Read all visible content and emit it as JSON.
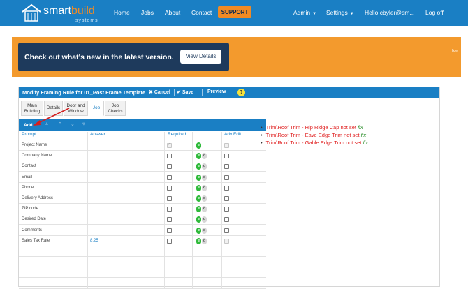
{
  "navbar": {
    "brand_main": "smart",
    "brand_accent": "build",
    "brand_sub": "systems",
    "links": [
      "Home",
      "Jobs",
      "About",
      "Contact"
    ],
    "support": "SUPPORT",
    "admin": "Admin",
    "settings": "Settings",
    "hello": "Hello cbyler@sm...",
    "logoff": "Log off"
  },
  "banner": {
    "text": "Check out what's new in the latest version.",
    "button": "View Details",
    "hide": "Hide"
  },
  "panel": {
    "title": "Modify Framing Rule for 01_Post Frame Template",
    "cancel": "Cancel",
    "save": "Save",
    "preview": "Preview",
    "help": "?"
  },
  "tabs": [
    {
      "label": "Main Building"
    },
    {
      "label": "Details"
    },
    {
      "label": "Door and Window"
    },
    {
      "label": "Job"
    },
    {
      "label": "Job Checks"
    }
  ],
  "grid": {
    "add": "Add",
    "columns": {
      "prompt": "Prompt",
      "answer": "Answer",
      "required": "Required",
      "adv_edit": "Adv Edit"
    },
    "rows": [
      {
        "prompt": "Project Name",
        "answer": ""
      },
      {
        "prompt": "Company Name",
        "answer": ""
      },
      {
        "prompt": "Contact",
        "answer": ""
      },
      {
        "prompt": "Email",
        "answer": ""
      },
      {
        "prompt": "Phone",
        "answer": ""
      },
      {
        "prompt": "Delivery Address",
        "answer": ""
      },
      {
        "prompt": "ZIP code",
        "answer": ""
      },
      {
        "prompt": "Desired Date",
        "answer": ""
      },
      {
        "prompt": "Comments",
        "answer": ""
      },
      {
        "prompt": "Sales Tax Rate",
        "answer": "8.25"
      }
    ],
    "edit_label": "e",
    "delete_label": "d"
  },
  "errors": [
    {
      "text": "Trim\\Roof Trim - Hip Ridge Cap not set",
      "fix": "fix"
    },
    {
      "text": "Trim\\Roof Trim - Eave Edge Trim not set",
      "fix": "fix"
    },
    {
      "text": "Trim\\Roof Trim - Gable Edge Trim not set",
      "fix": "fix"
    }
  ],
  "colors": {
    "primary": "#1a7fc4",
    "accent": "#f08a24",
    "error": "#e02020",
    "fix": "#2b8f2b"
  }
}
